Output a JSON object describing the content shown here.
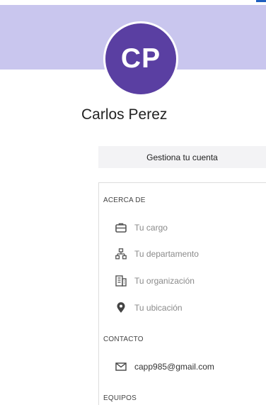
{
  "profile": {
    "initials": "CP",
    "name": "Carlos Perez",
    "avatar_color": "#5a3fa2",
    "banner_color": "#c9c6ee"
  },
  "manage_button_label": "Gestiona tu cuenta",
  "about": {
    "title": "ACERCA DE",
    "items": [
      {
        "icon": "briefcase-icon",
        "label": "Tu cargo"
      },
      {
        "icon": "org-chart-icon",
        "label": "Tu departamento"
      },
      {
        "icon": "building-icon",
        "label": "Tu organización"
      },
      {
        "icon": "location-pin-icon",
        "label": "Tu ubicación"
      }
    ]
  },
  "contact": {
    "title": "CONTACTO",
    "email": "capp985@gmail.com",
    "icon": "mail-icon"
  },
  "teams": {
    "title": "EQUIPOS"
  }
}
